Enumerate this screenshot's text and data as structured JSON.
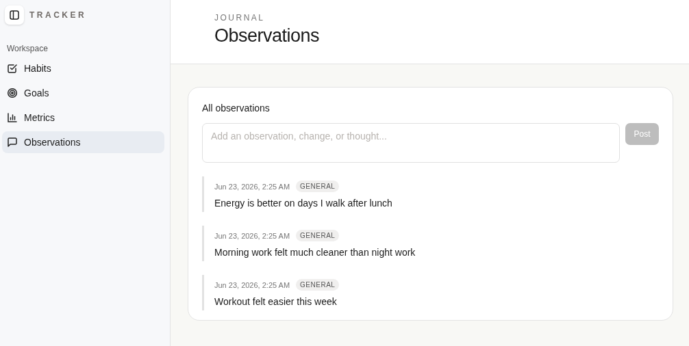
{
  "sidebar": {
    "brand": "TRACKER",
    "section": "Workspace",
    "items": [
      {
        "label": "Habits",
        "selected": false
      },
      {
        "label": "Goals",
        "selected": false
      },
      {
        "label": "Metrics",
        "selected": false
      },
      {
        "label": "Observations",
        "selected": true
      }
    ]
  },
  "header": {
    "eyebrow": "JOURNAL",
    "title": "Observations"
  },
  "card": {
    "title": "All observations",
    "composer": {
      "placeholder": "Add an observation, change, or thought..."
    },
    "post_button": {
      "label": "Post",
      "disabled": true
    },
    "entries": [
      {
        "time": "Jun 23, 2026, 2:25 AM",
        "tag": "GENERAL",
        "text": "Energy is better on days I walk after lunch"
      },
      {
        "time": "Jun 23, 2026, 2:25 AM",
        "tag": "GENERAL",
        "text": "Morning work felt much cleaner than night work"
      },
      {
        "time": "Jun 23, 2026, 2:25 AM",
        "tag": "GENERAL",
        "text": "Workout felt easier this week"
      }
    ]
  }
}
